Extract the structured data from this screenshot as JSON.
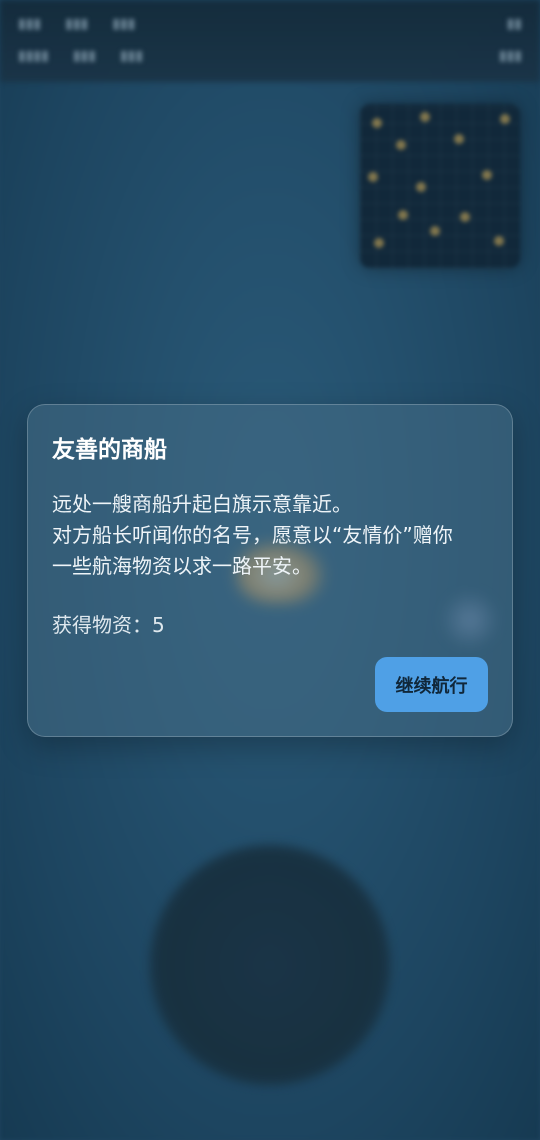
{
  "dialog": {
    "title": "友善的商船",
    "body_lines": [
      "远处一艘商船升起白旗示意靠近。",
      "对方船长听闻你的名号，愿意以“友情价”赠你",
      "一些航海物资以求一路平安。"
    ],
    "reward_label": "获得物资：",
    "reward_value": "5",
    "continue_label": "继续航行"
  },
  "colors": {
    "button": "#4fa0e6",
    "dialog_bg": "#466e87",
    "sea": "#24506d"
  }
}
